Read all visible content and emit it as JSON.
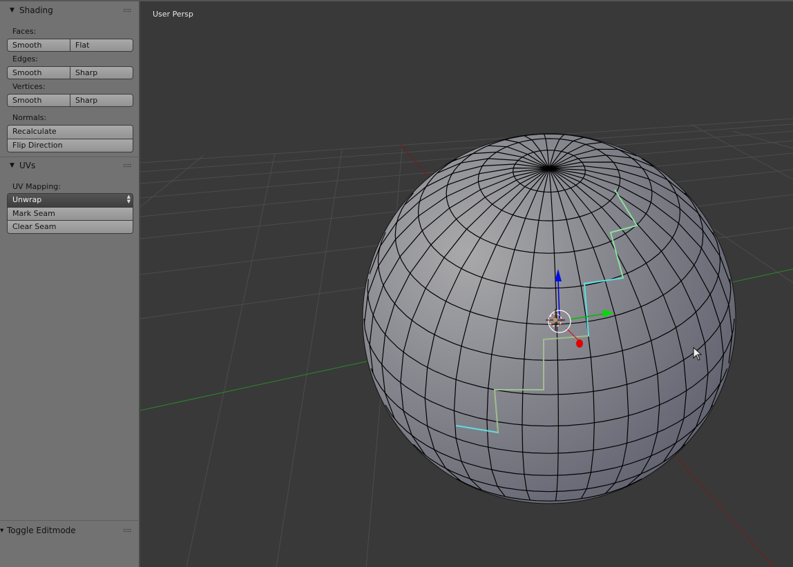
{
  "toolshelf": {
    "shading": {
      "title": "Shading",
      "faces_label": "Faces:",
      "faces_buttons": [
        "Smooth",
        "Flat"
      ],
      "edges_label": "Edges:",
      "edges_buttons": [
        "Smooth",
        "Sharp"
      ],
      "vertices_label": "Vertices:",
      "vertices_buttons": [
        "Smooth",
        "Sharp"
      ],
      "normals_label": "Normals:",
      "normals_buttons": [
        "Recalculate",
        "Flip Direction"
      ]
    },
    "uvs": {
      "title": "UVs",
      "mapping_label": "UV Mapping:",
      "mapping_menu": "Unwrap",
      "seam_buttons": [
        "Mark Seam",
        "Clear Seam"
      ]
    },
    "last_operator": {
      "title": "Toggle Editmode"
    }
  },
  "viewport": {
    "view_label": "User Persp",
    "colors": {
      "background": "#393939",
      "grid": "#4d4d4d",
      "x_axis": "#8a1f1f",
      "y_axis": "#2a8a2a",
      "mesh_face": "#8a8b94",
      "mesh_wire": "#000000",
      "seam_selected": "#5ce0e0",
      "seam_active": "#e8a040",
      "gizmo_z": "#0000dd",
      "gizmo_y": "#00cc00",
      "gizmo_x": "#dd0000"
    },
    "object": "UV Sphere",
    "mode": "Edit Mode"
  }
}
